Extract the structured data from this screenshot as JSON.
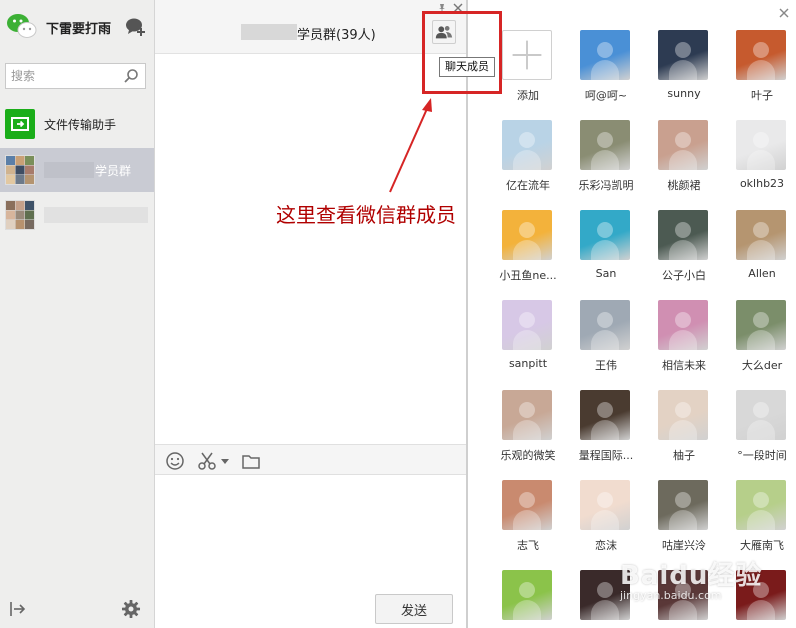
{
  "sidebar": {
    "user_name": "下雷要打雨",
    "search_placeholder": "搜索",
    "conversations": [
      {
        "name": "文件传输助手"
      },
      {
        "name": "学员群"
      },
      {
        "name": ""
      }
    ]
  },
  "chat": {
    "title": "学员群(39人)",
    "tooltip": "聊天成员",
    "annotation": "这里查看微信群成员",
    "send_label": "发送"
  },
  "members": {
    "add_label": "添加",
    "list": [
      {
        "name": "呵@呵~",
        "color": "#4a90d6"
      },
      {
        "name": "sunny",
        "color": "#2d3b52"
      },
      {
        "name": "叶子",
        "color": "#c65a2e"
      },
      {
        "name": "亿在流年",
        "color": "#b9d3e6"
      },
      {
        "name": "乐彩冯凯明",
        "color": "#8a8d73"
      },
      {
        "name": "桃颜裙",
        "color": "#c9a08f"
      },
      {
        "name": "oklhb23",
        "color": "#e9e9ea"
      },
      {
        "name": "小丑鱼ne...",
        "color": "#f3b23b"
      },
      {
        "name": "San",
        "color": "#33a9c8"
      },
      {
        "name": "公子小白",
        "color": "#4c5a52"
      },
      {
        "name": "Allen",
        "color": "#b59570"
      },
      {
        "name": "sanpitt",
        "color": "#d7c8e6"
      },
      {
        "name": "王伟",
        "color": "#9fa9b4"
      },
      {
        "name": "相信未来",
        "color": "#d08fb2"
      },
      {
        "name": "大么der",
        "color": "#7b8e6a"
      },
      {
        "name": "乐观的微笑",
        "color": "#c8a896"
      },
      {
        "name": "量程国际...",
        "color": "#4a3b30"
      },
      {
        "name": "柚子",
        "color": "#e3d2c4"
      },
      {
        "name": "°一段时间",
        "color": "#d8d8d8"
      },
      {
        "name": "志飞",
        "color": "#c98a6f"
      },
      {
        "name": "恋沫",
        "color": "#f1dccf"
      },
      {
        "name": "咕崖兴泠",
        "color": "#6d6a5d"
      },
      {
        "name": "大雁南飞",
        "color": "#b6cf8a"
      },
      {
        "name": "",
        "color": "#8bc34a"
      },
      {
        "name": "",
        "color": "#3a2a2a"
      },
      {
        "name": "",
        "color": "#5a3838"
      },
      {
        "name": "",
        "color": "#7a1b1b"
      }
    ]
  },
  "watermark": {
    "brand": "Baidu经验",
    "url": "jingyan.baidu.com"
  },
  "colors": {
    "accent_green": "#1aad19",
    "annotation_red": "#d62525",
    "selected_row": "#c9cbd3"
  }
}
